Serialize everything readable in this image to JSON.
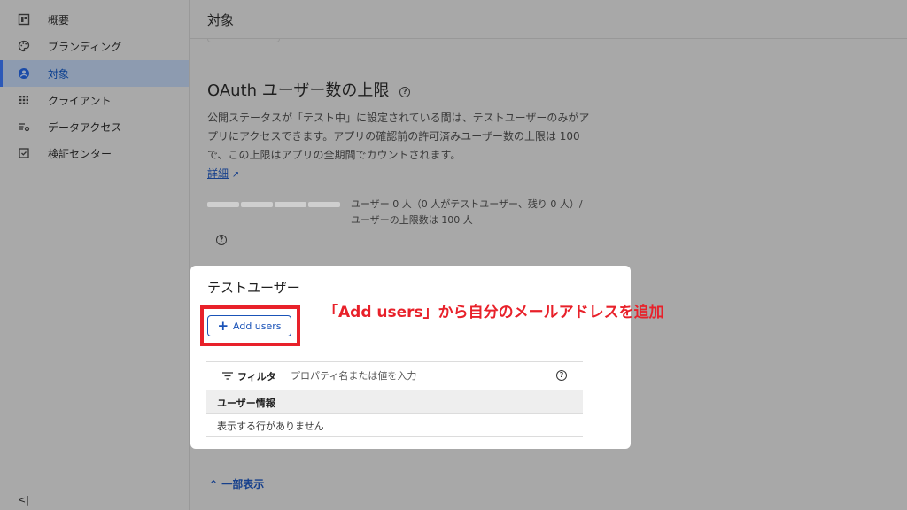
{
  "sidebar": {
    "items": [
      {
        "label": "概要",
        "icon": "dashboard-icon"
      },
      {
        "label": "ブランディング",
        "icon": "palette-icon"
      },
      {
        "label": "対象",
        "icon": "account-circle-icon",
        "active": true
      },
      {
        "label": "クライアント",
        "icon": "grid-icon"
      },
      {
        "label": "データアクセス",
        "icon": "settings-list-icon"
      },
      {
        "label": "検証センター",
        "icon": "checkbox-icon"
      }
    ],
    "collapse_icon": "collapse-sidebar-icon"
  },
  "header": {
    "title": "対象"
  },
  "oauth": {
    "title": "OAuth ユーザー数の上限",
    "description": "公開ステータスが「テスト中」に設定されている間は、テストユーザーのみがアプリにアクセスできます。アプリの確認前の許可済みユーザー数の上限は 100 で、この上限はアプリの全期間でカウントされます。",
    "learn_more": "詳細",
    "usage_text": "ユーザー 0 人（0 人がテストユーザー、残り 0 人）/ ユーザーの上限数は 100 人",
    "usage_fraction": 0
  },
  "test_users": {
    "title": "テストユーザー",
    "add_button": "Add users",
    "annotation": "「Add users」から自分のメールアドレスを追加",
    "filter_label": "フィルタ",
    "filter_placeholder": "プロパティ名または値を入力",
    "column_header": "ユーザー情報",
    "empty_message": "表示する行がありません"
  },
  "footer": {
    "show_less": "一部表示"
  },
  "colors": {
    "accent": "#1a53b8",
    "highlight": "#e8212a",
    "overlay": "#a8a8a8"
  }
}
